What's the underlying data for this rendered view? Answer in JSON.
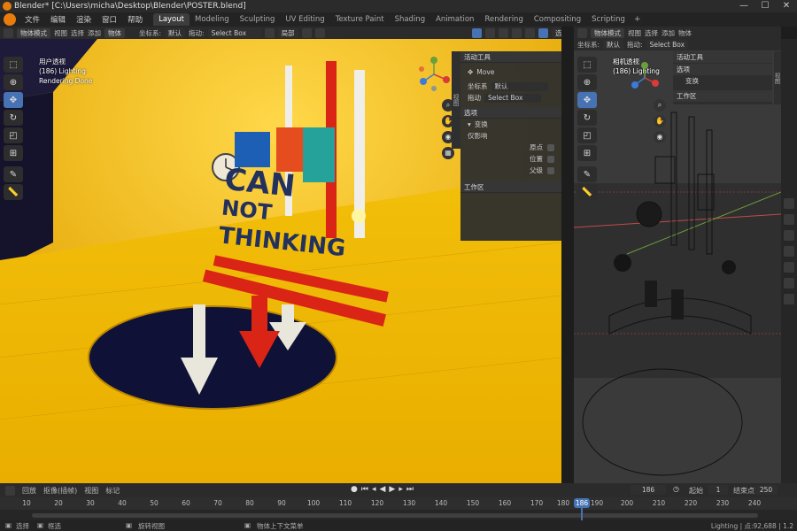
{
  "window": {
    "title": "Blender* [C:\\Users\\micha\\Desktop\\Blender\\POSTER.blend]",
    "min": "—",
    "max": "☐",
    "close": "✕"
  },
  "menu": [
    "文件",
    "编辑",
    "渲染",
    "窗口",
    "帮助"
  ],
  "workspaces": [
    "Layout",
    "Modeling",
    "Sculpting",
    "UV Editing",
    "Texture Paint",
    "Shading",
    "Animation",
    "Rendering",
    "Compositing",
    "Scripting"
  ],
  "workspace_add": "+",
  "scene_options": "选项",
  "left_viewport": {
    "mode": "物体模式",
    "menu": [
      "视图",
      "选择",
      "添加",
      "物体"
    ],
    "coord_label": "坐标系:",
    "coord_value": "默认",
    "drag_label": "拖动:",
    "drag_value": "Select Box",
    "pivot": "局部",
    "options": "选项",
    "overlay_lines": [
      "用户透视",
      "(186) Lighting",
      "Rendering Done"
    ],
    "sidetab": "视图",
    "npanel": {
      "active_tool": "活动工具",
      "tool_name": "Move",
      "coord_label": "坐标系",
      "coord_value": "默认",
      "drag_label": "拖动",
      "drag_value": "Select Box",
      "options": "选项",
      "transform": "变换",
      "affect_only": "仅影响",
      "origin": "原点",
      "locations": "位置",
      "parents": "父级",
      "workspace": "工作区"
    }
  },
  "right_viewport": {
    "mode": "物体模式",
    "menu": [
      "视图",
      "选择",
      "添加",
      "物体"
    ],
    "coord_label": "坐标系:",
    "coord_value": "默认",
    "drag_label": "拖动:",
    "drag_value": "Select Box",
    "overlay_lines": [
      "相机透视",
      "(186) Lighting"
    ],
    "sidetab": "视图",
    "npanel": {
      "active_tool": "活动工具",
      "options": "选项",
      "transform": "变换",
      "workspace": "工作区"
    }
  },
  "poster_text": [
    "CAN",
    "NOT",
    "THINKING"
  ],
  "timeline": {
    "menu": [
      "回放",
      "抠像(插帧)",
      "视图",
      "标记"
    ],
    "current_frame": "186",
    "start_label": "起始",
    "start_value": "1",
    "end_label": "结束点",
    "end_value": "250",
    "ticks": [
      "10",
      "20",
      "30",
      "40",
      "50",
      "60",
      "70",
      "80",
      "90",
      "100",
      "110",
      "120",
      "130",
      "140",
      "150",
      "160",
      "170",
      "180",
      "190",
      "200",
      "210",
      "220",
      "230",
      "240"
    ]
  },
  "status": {
    "select": "选择",
    "box_select": "框选",
    "rotate_view": "旋转视图",
    "context_menu": "物体上下文菜单",
    "stats": "Lighting | 点:92,688 | 1.2"
  },
  "colors": {
    "accent": "#4772b3",
    "poster_yellow": "#f1b800",
    "blender_orange": "#e87d0d"
  }
}
